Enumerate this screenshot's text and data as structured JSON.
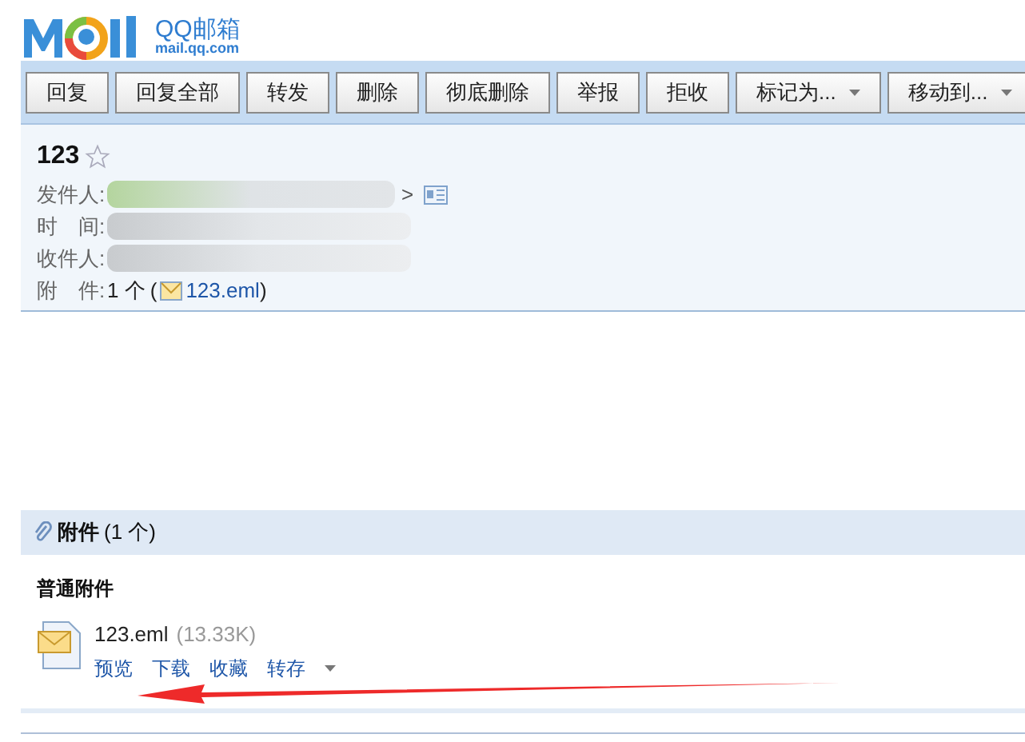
{
  "logo": {
    "brand": "QQ邮箱",
    "domain": "mail.qq.com"
  },
  "toolbar": [
    {
      "label": "回复",
      "dropdown": false
    },
    {
      "label": "回复全部",
      "dropdown": false
    },
    {
      "label": "转发",
      "dropdown": false
    },
    {
      "label": "删除",
      "dropdown": false
    },
    {
      "label": "彻底删除",
      "dropdown": false
    },
    {
      "label": "举报",
      "dropdown": false
    },
    {
      "label": "拒收",
      "dropdown": false
    },
    {
      "label": "标记为...",
      "dropdown": true
    },
    {
      "label": "移动到...",
      "dropdown": true
    }
  ],
  "message": {
    "subject": "123",
    "starred": false,
    "fields": [
      {
        "label": "发件人:",
        "kind": "redacted",
        "suffix": ">"
      },
      {
        "label": "时　间:",
        "kind": "redacted"
      },
      {
        "label": "收件人:",
        "kind": "redacted"
      },
      {
        "label": "附　件:",
        "kind": "attachment",
        "count": "1 个",
        "open": "(",
        "file": "123.eml",
        "close": ")"
      }
    ]
  },
  "attachments": {
    "title": "附件",
    "count": "(1 个)",
    "group": "普通附件",
    "items": [
      {
        "name": "123.eml",
        "size": "(13.33K)",
        "actions": [
          "预览",
          "下载",
          "收藏",
          "转存"
        ]
      }
    ]
  }
}
